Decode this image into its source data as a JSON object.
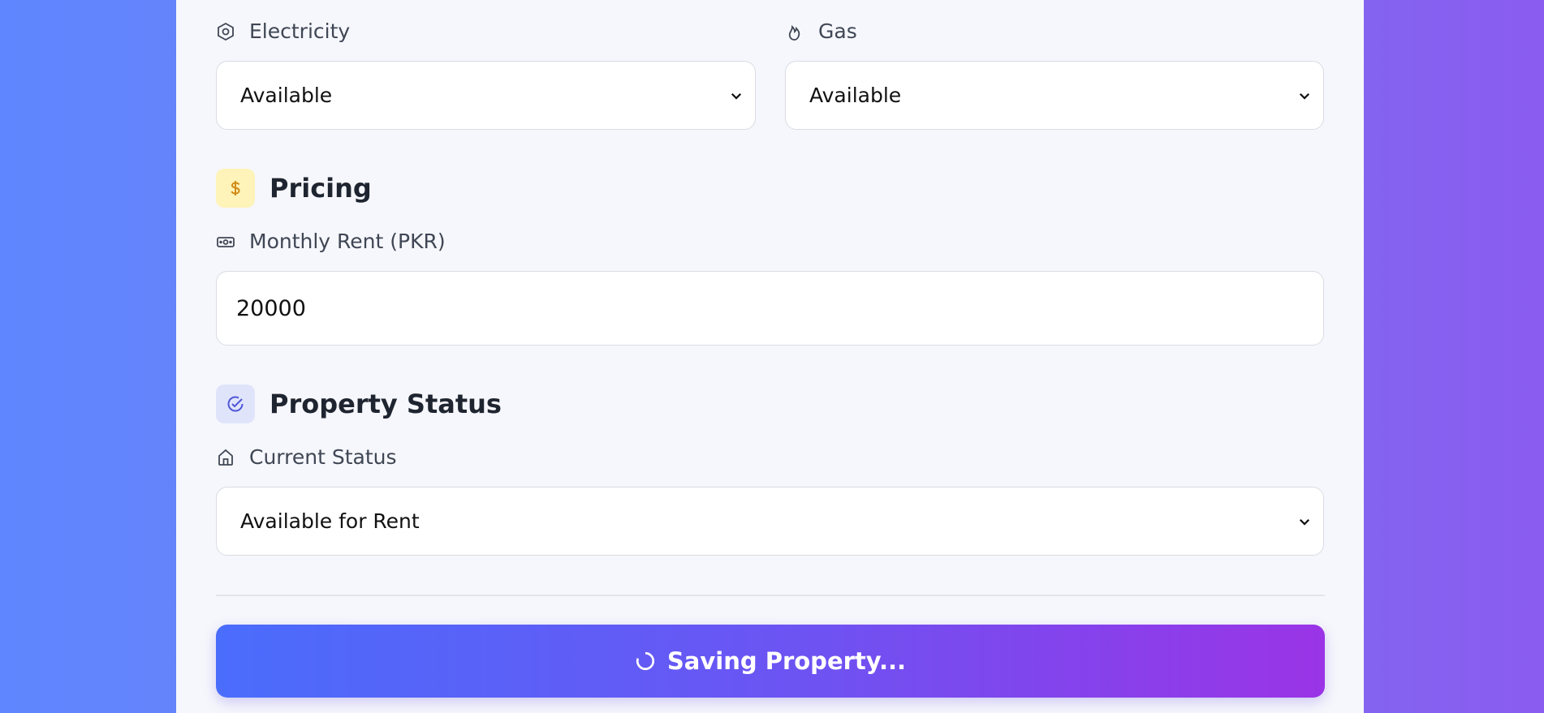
{
  "utilities": {
    "electricity": {
      "label": "Electricity",
      "value": "Available"
    },
    "gas": {
      "label": "Gas",
      "value": "Available"
    }
  },
  "pricing": {
    "heading": "Pricing",
    "rent_label": "Monthly Rent (PKR)",
    "rent_value": "20000"
  },
  "status": {
    "heading": "Property Status",
    "current_label": "Current Status",
    "current_value": "Available for Rent"
  },
  "submit": {
    "label": "Saving Property..."
  },
  "colors": {
    "accent_start": "#4a6dfc",
    "accent_end": "#9a34e6",
    "pricing_badge_bg": "#fef3b8",
    "pricing_badge_fg": "#d08a16",
    "status_badge_bg": "#e0e4fb",
    "status_badge_fg": "#4f55d6"
  },
  "icons": {
    "electricity": "hexagon-gear-icon",
    "gas": "flame-icon",
    "pricing": "dollar-icon",
    "rent": "banknote-icon",
    "status": "check-circle-icon",
    "current_status": "home-icon",
    "saving": "spinner-icon"
  }
}
